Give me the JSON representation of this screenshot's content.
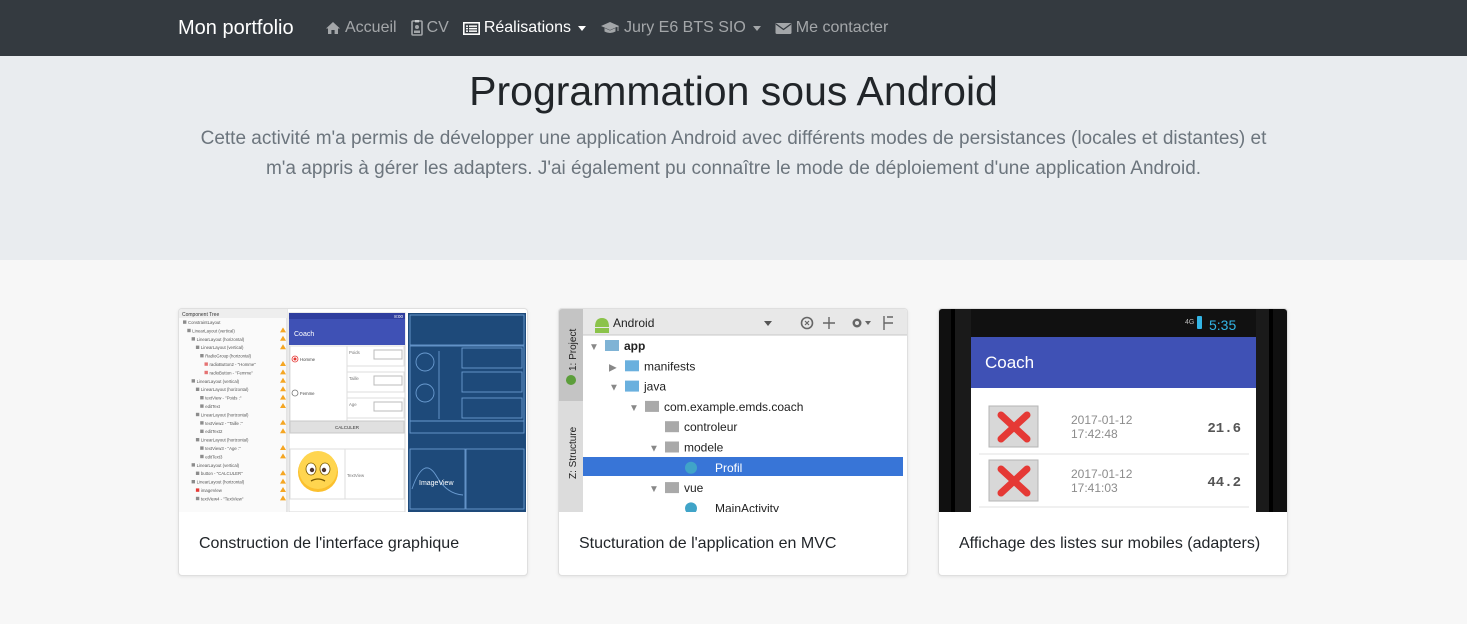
{
  "navbar": {
    "brand": "Mon portfolio",
    "items": [
      {
        "label": "Accueil",
        "icon": "home-icon",
        "active": false,
        "dropdown": false
      },
      {
        "label": "CV",
        "icon": "id-badge-icon",
        "active": false,
        "dropdown": false
      },
      {
        "label": "Réalisations",
        "icon": "list-alt-icon",
        "active": true,
        "dropdown": true
      },
      {
        "label": "Jury E6 BTS SIO",
        "icon": "graduation-cap-icon",
        "active": false,
        "dropdown": true
      },
      {
        "label": "Me contacter",
        "icon": "envelope-icon",
        "active": false,
        "dropdown": false
      }
    ]
  },
  "jumbotron": {
    "title": "Programmation sous Android",
    "lead": "Cette activité m'a permis de développer une application Android avec différents modes de persistances (locales et distantes) et m'a appris à gérer les adapters. J'ai également pu connaître le mode de déploiement d'une application Android."
  },
  "cards": [
    {
      "title": "Construction de l'interface graphique",
      "screenshot": {
        "panel_title": "Component Tree",
        "app_bar": "Coach",
        "time": "8:00",
        "radio_1": "Homme",
        "radio_2": "Femme",
        "field_1": "Poids",
        "field_2": "Taille",
        "field_3": "Age",
        "button": "CALCULER",
        "text_view": "TextView",
        "image_view": "ImageView",
        "tree": [
          "ConstraintLayout",
          "LinearLayout (vertical)",
          "LinearLayout (horizontal)",
          "LinearLayout (vertical)",
          "RadioGroup (horizontal)",
          "radioButton2 - \"Homme\"",
          "radioButton - \"Femme\"",
          "LinearLayout (vertical)",
          "LinearLayout (horizontal)",
          "textView - \"Poids :\"",
          "editText",
          "LinearLayout (horizontal)",
          "textView2 - \"Taille :\"",
          "editText2",
          "LinearLayout (horizontal)",
          "textView3 - \"Age :\"",
          "editText3",
          "LinearLayout (vertical)",
          "button - \"CALCULER\"",
          "LinearLayout (horizontal)",
          "imageView",
          "textView4 - \"TextView\""
        ]
      }
    },
    {
      "title": "Stucturation de l'application en MVC",
      "screenshot": {
        "side_tab_1": "1: Project",
        "side_tab_2": "Z: Structure",
        "dropdown": "Android",
        "tree": [
          {
            "label": "app",
            "level": 0,
            "arrow": "▼",
            "type": "module"
          },
          {
            "label": "manifests",
            "level": 1,
            "arrow": "▶",
            "type": "folder"
          },
          {
            "label": "java",
            "level": 1,
            "arrow": "▼",
            "type": "folder"
          },
          {
            "label": "com.example.emds.coach",
            "level": 2,
            "arrow": "▼",
            "type": "package"
          },
          {
            "label": "controleur",
            "level": 3,
            "arrow": "",
            "type": "package"
          },
          {
            "label": "modele",
            "level": 3,
            "arrow": "▼",
            "type": "package"
          },
          {
            "label": "Profil",
            "level": 4,
            "arrow": "",
            "type": "class",
            "selected": true
          },
          {
            "label": "vue",
            "level": 3,
            "arrow": "▼",
            "type": "package"
          },
          {
            "label": "MainActivity",
            "level": 4,
            "arrow": "",
            "type": "class"
          }
        ]
      }
    },
    {
      "title": "Affichage des listes sur mobiles (adapters)",
      "screenshot": {
        "signal": "4G",
        "time": "5:35",
        "app_bar": "Coach",
        "rows": [
          {
            "date": "2017-01-12",
            "time": "17:42:48",
            "value": "21.6"
          },
          {
            "date": "2017-01-12",
            "time": "17:41:03",
            "value": "44.2"
          }
        ]
      }
    }
  ],
  "colors": {
    "navbar_bg": "#343a40",
    "jumbotron_bg": "#e9ecef",
    "android_app_bar": "#3f51b5",
    "ide_selection": "#3875d7"
  }
}
